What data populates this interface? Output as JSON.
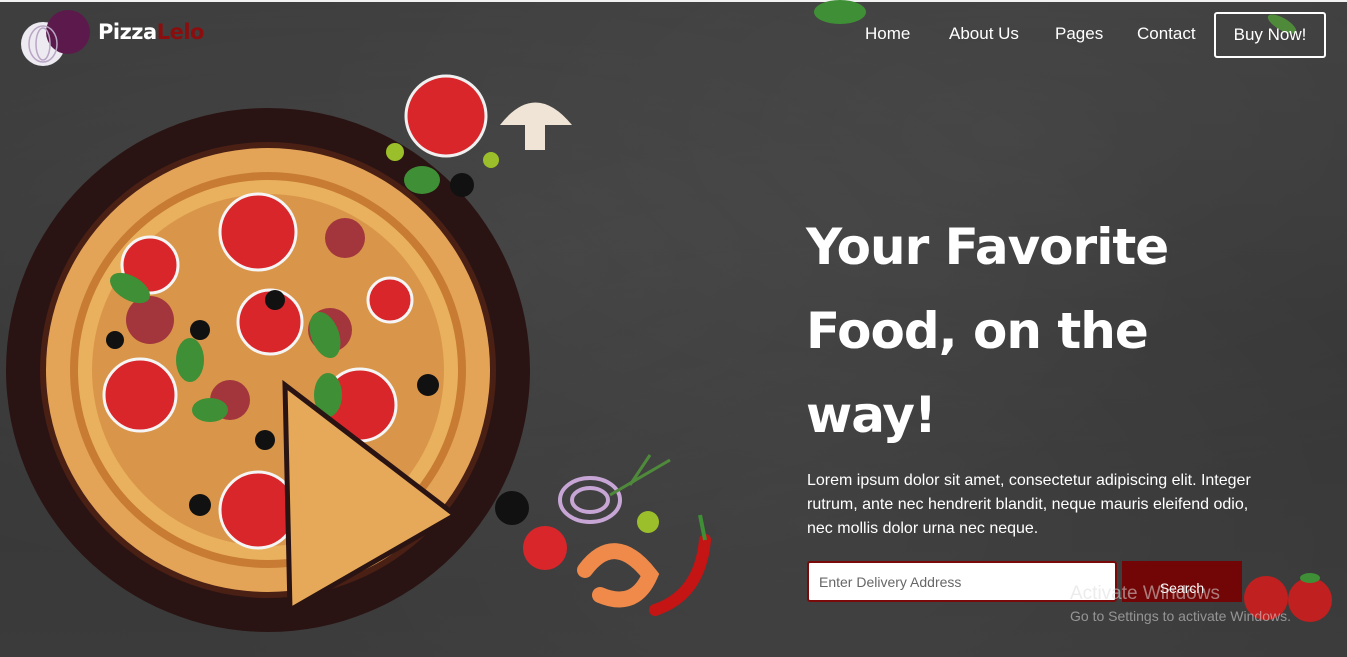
{
  "brand": {
    "name_part1": "Pizza",
    "name_part2": "Lelo"
  },
  "nav": {
    "items": [
      {
        "label": "Home"
      },
      {
        "label": "About Us"
      },
      {
        "label": "Pages"
      },
      {
        "label": "Contact"
      }
    ],
    "cta_label": "Buy Now!"
  },
  "hero": {
    "headline_lines": [
      "Your Favorite",
      "Food, on the",
      "way!"
    ],
    "description": "Lorem ipsum dolor sit amet, consectetur adipiscing elit. Integer rutrum, ante nec hendrerit blandit, neque mauris eleifend odio, nec mollis dolor urna nec neque.",
    "search_placeholder": "Enter Delivery Address",
    "search_button": "Search"
  },
  "watermark": {
    "title": "Activate Windows",
    "subtitle": "Go to Settings to activate Windows."
  },
  "colors": {
    "brand_red": "#8b0d0d",
    "button_red": "#720606",
    "text": "#ffffff",
    "background": "#3a3a3a"
  },
  "icons": [
    "onion-logo-icon",
    "pizza-illustration",
    "tomato-icon",
    "mushroom-icon",
    "olive-icon",
    "shrimp-icon",
    "chili-icon",
    "basil-icon"
  ]
}
